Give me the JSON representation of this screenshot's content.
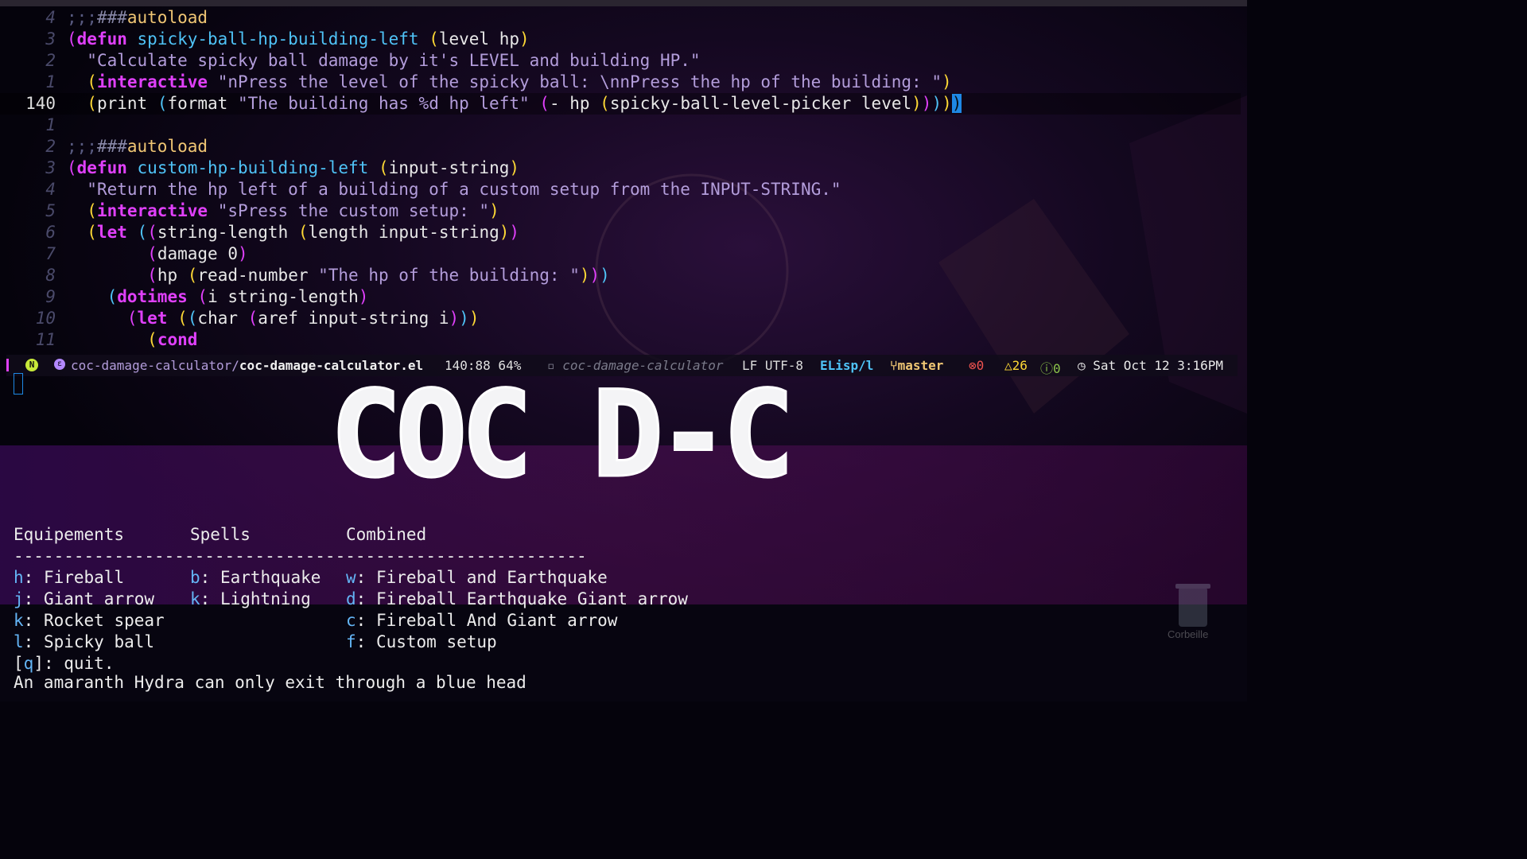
{
  "editor": {
    "lines": [
      {
        "num": "4",
        "html": "<span class=\"cmt\">;;;</span><span class=\"cmt2\">###</span><span class=\"cookie\">autoload</span>"
      },
      {
        "num": "3",
        "html": "<span class=\"p1\">(</span><span class=\"kw\">defun</span> <span class=\"fn\">spicky-ball-hp-building-left</span> <span class=\"p2\">(</span>level hp<span class=\"p2\">)</span>"
      },
      {
        "num": "2",
        "html": "  <span class=\"str\">\"Calculate spicky ball damage by it's LEVEL and building HP.\"</span>"
      },
      {
        "num": "1",
        "html": "  <span class=\"p2\">(</span><span class=\"kw\">interactive</span> <span class=\"str\">\"nPress the level of the spicky ball: \\nnPress the hp of the building: \"</span><span class=\"p2\">)</span>"
      },
      {
        "num": "140",
        "current": true,
        "html": "  <span class=\"p2\">(</span>print <span class=\"p3\">(</span>format <span class=\"str\">\"The building has %d hp left\"</span> <span class=\"p1\">(</span>- hp <span class=\"p2\">(</span>spicky-ball-level-picker level<span class=\"p2\">)</span><span class=\"p1\">)</span><span class=\"p3\">)</span><span class=\"p2\">)</span><span class=\"cursor-box\">)</span>"
      },
      {
        "num": "1",
        "html": ""
      },
      {
        "num": "2",
        "html": "<span class=\"cmt\">;;;</span><span class=\"cmt2\">###</span><span class=\"cookie\">autoload</span>"
      },
      {
        "num": "3",
        "html": "<span class=\"p1\">(</span><span class=\"kw\">defun</span> <span class=\"fn\">custom-hp-building-left</span> <span class=\"p2\">(</span>input-string<span class=\"p2\">)</span>"
      },
      {
        "num": "4",
        "html": "  <span class=\"str\">\"Return the hp left of a building of a custom setup from the INPUT-STRING.\"</span>"
      },
      {
        "num": "5",
        "html": "  <span class=\"p2\">(</span><span class=\"kw\">interactive</span> <span class=\"str\">\"sPress the custom setup: \"</span><span class=\"p2\">)</span>"
      },
      {
        "num": "6",
        "html": "  <span class=\"p2\">(</span><span class=\"kw\">let</span> <span class=\"p3\">(</span><span class=\"p1\">(</span>string-length <span class=\"p2\">(</span>length input-string<span class=\"p2\">)</span><span class=\"p1\">)</span>"
      },
      {
        "num": "7",
        "html": "        <span class=\"p1\">(</span>damage 0<span class=\"p1\">)</span>"
      },
      {
        "num": "8",
        "html": "        <span class=\"p1\">(</span>hp <span class=\"p2\">(</span>read-number <span class=\"str\">\"The hp of the building: \"</span><span class=\"p2\">)</span><span class=\"p1\">)</span><span class=\"p3\">)</span>"
      },
      {
        "num": "9",
        "html": "    <span class=\"p3\">(</span><span class=\"kw\">dotimes</span> <span class=\"p1\">(</span>i string-length<span class=\"p1\">)</span>"
      },
      {
        "num": "10",
        "html": "      <span class=\"p1\">(</span><span class=\"kw\">let</span> <span class=\"p2\">(</span><span class=\"p3\">(</span>char <span class=\"p1\">(</span>aref input-string i<span class=\"p1\">)</span><span class=\"p3\">)</span><span class=\"p2\">)</span>"
      },
      {
        "num": "11",
        "html": "        <span class=\"p2\">(</span><span class=\"kw\">cond</span>"
      }
    ]
  },
  "modeline": {
    "state_badge": "N",
    "dir": "coc-damage-calculator/",
    "file": "coc-damage-calculator.el",
    "position": "140:88 64%",
    "project": "coc-damage-calculator",
    "encoding": "LF UTF-8",
    "major_mode": "ELisp/l",
    "branch": "master",
    "errors": "0",
    "warnings": "26",
    "infos": "0",
    "clock": "Sat Oct 12 3:16PM"
  },
  "banner": {
    "text": "COC D-C"
  },
  "hydra": {
    "headers": {
      "equipements": "Equipements",
      "spells": "Spells",
      "combined": "Combined"
    },
    "separator": "---------------------------------------------------------",
    "equipements": [
      {
        "key": "h",
        "label": "Fireball"
      },
      {
        "key": "j",
        "label": "Giant arrow"
      },
      {
        "key": "k",
        "label": "Rocket spear"
      },
      {
        "key": "l",
        "label": "Spicky ball"
      }
    ],
    "spells": [
      {
        "key": "b",
        "label": "Earthquake"
      },
      {
        "key": "k",
        "label": "Lightning"
      }
    ],
    "combined": [
      {
        "key": "w",
        "label": "Fireball and Earthquake"
      },
      {
        "key": "d",
        "label": "Fireball Earthquake Giant arrow"
      },
      {
        "key": "c",
        "label": "Fireball And Giant arrow"
      },
      {
        "key": "f",
        "label": "Custom setup"
      }
    ],
    "quit_key": "q",
    "quit_label": "quit.",
    "hint": "An amaranth Hydra can only exit through a blue head"
  },
  "desktop": {
    "trash_label": "Corbeille"
  },
  "colors": {
    "accent": "#e040fb",
    "function": "#4fc3f7",
    "string": "#b39ddb",
    "paren": "#fdd835",
    "key": "#64b5f6",
    "cursor": "#1e88e5"
  },
  "icons": [
    "evil-state-icon",
    "emacs-file-icon",
    "project-icon",
    "git-branch-icon",
    "error-icon",
    "warning-icon",
    "info-icon",
    "clock-icon",
    "trash-icon"
  ]
}
